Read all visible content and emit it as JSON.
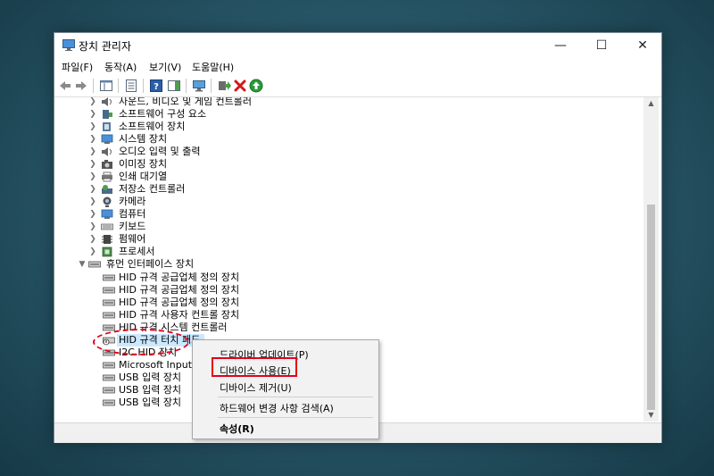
{
  "window": {
    "title": "장치 관리자",
    "controls": {
      "minimize": "—",
      "maximize": "☐",
      "close": "✕"
    }
  },
  "menu": [
    "파일(F)",
    "동작(A)",
    "보기(V)",
    "도움말(H)"
  ],
  "tree": [
    {
      "label": "사운드, 비디오 및 게임 컨트롤러",
      "expanded": false,
      "icon": "speaker-icon"
    },
    {
      "label": "소프트웨어 구성 요소",
      "expanded": false,
      "icon": "software-component-icon"
    },
    {
      "label": "소프트웨어 장치",
      "expanded": false,
      "icon": "software-device-icon"
    },
    {
      "label": "시스템 장치",
      "expanded": false,
      "icon": "system-device-icon"
    },
    {
      "label": "오디오 입력 및 출력",
      "expanded": false,
      "icon": "audio-io-icon"
    },
    {
      "label": "이미징 장치",
      "expanded": false,
      "icon": "camera-icon"
    },
    {
      "label": "인쇄 대기열",
      "expanded": false,
      "icon": "printer-icon"
    },
    {
      "label": "저장소 컨트롤러",
      "expanded": false,
      "icon": "storage-controller-icon"
    },
    {
      "label": "카메라",
      "expanded": false,
      "icon": "webcam-icon"
    },
    {
      "label": "컴퓨터",
      "expanded": false,
      "icon": "computer-icon"
    },
    {
      "label": "키보드",
      "expanded": false,
      "icon": "keyboard-icon"
    },
    {
      "label": "펌웨어",
      "expanded": false,
      "icon": "firmware-icon"
    },
    {
      "label": "프로세서",
      "expanded": false,
      "icon": "processor-icon"
    },
    {
      "label": "휴먼 인터페이스 장치",
      "expanded": true,
      "icon": "hid-icon"
    }
  ],
  "hid_children": [
    "HID 규격 공급업체 정의 장치",
    "HID 규격 공급업체 정의 장치",
    "HID 규격 공급업체 정의 장치",
    "HID 규격 사용자 컨트롤 장치",
    "HID 규격 시스템 컨트롤러",
    "HID 규격 터치 패드",
    "I2C HID 장치",
    "Microsoft Input C",
    "USB 입력 장치",
    "USB 입력 장치",
    "USB 입력 장치"
  ],
  "selected_child_index": 5,
  "context_menu": {
    "items": [
      "드라이버 업데이트(P)",
      "디바이스 사용(E)",
      "디바이스 제거(U)",
      "하드웨어 변경 사항 검색(A)",
      "속성(R)"
    ],
    "highlighted_index": 1
  },
  "colors": {
    "highlight": "#e3001b",
    "selection": "#cce8ff"
  }
}
